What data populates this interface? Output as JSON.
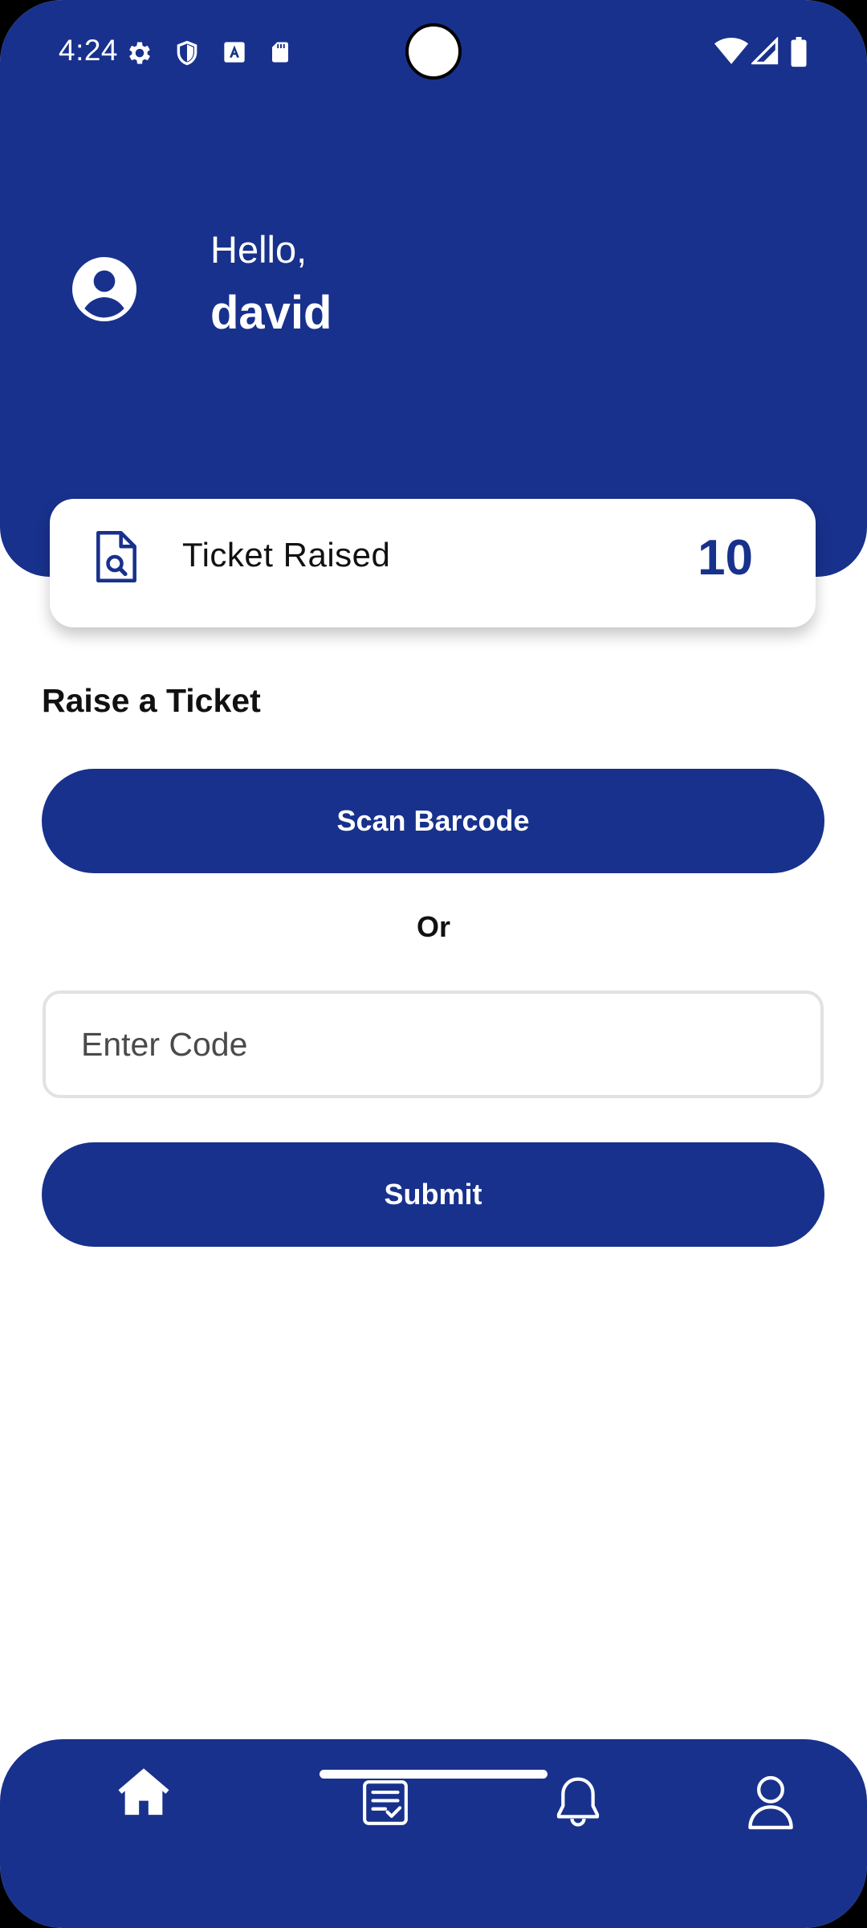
{
  "status_bar": {
    "time": "4:24",
    "icons": [
      "gear-icon",
      "shield-icon",
      "text-a-icon",
      "sd-card-icon",
      "wifi-icon",
      "signal-icon",
      "battery-icon"
    ]
  },
  "header": {
    "greeting": "Hello,",
    "username": "david"
  },
  "stats_card": {
    "label": "Ticket Raised",
    "value": "10",
    "icon": "document-search-icon"
  },
  "raise_ticket": {
    "title": "Raise a Ticket",
    "scan_button_label": "Scan Barcode",
    "or_text": "Or",
    "code_input": {
      "placeholder": "Enter Code",
      "value": ""
    },
    "submit_button_label": "Submit"
  },
  "bottom_nav": {
    "items": [
      {
        "name": "home",
        "icon": "home-icon",
        "active": true
      },
      {
        "name": "tickets",
        "icon": "checklist-icon",
        "active": false
      },
      {
        "name": "notifications",
        "icon": "bell-icon",
        "active": false
      },
      {
        "name": "profile",
        "icon": "person-icon",
        "active": false
      }
    ]
  },
  "colors": {
    "primary": "#18318c",
    "background": "#ffffff",
    "text": "#111111",
    "input_border": "#e2e2e2"
  }
}
